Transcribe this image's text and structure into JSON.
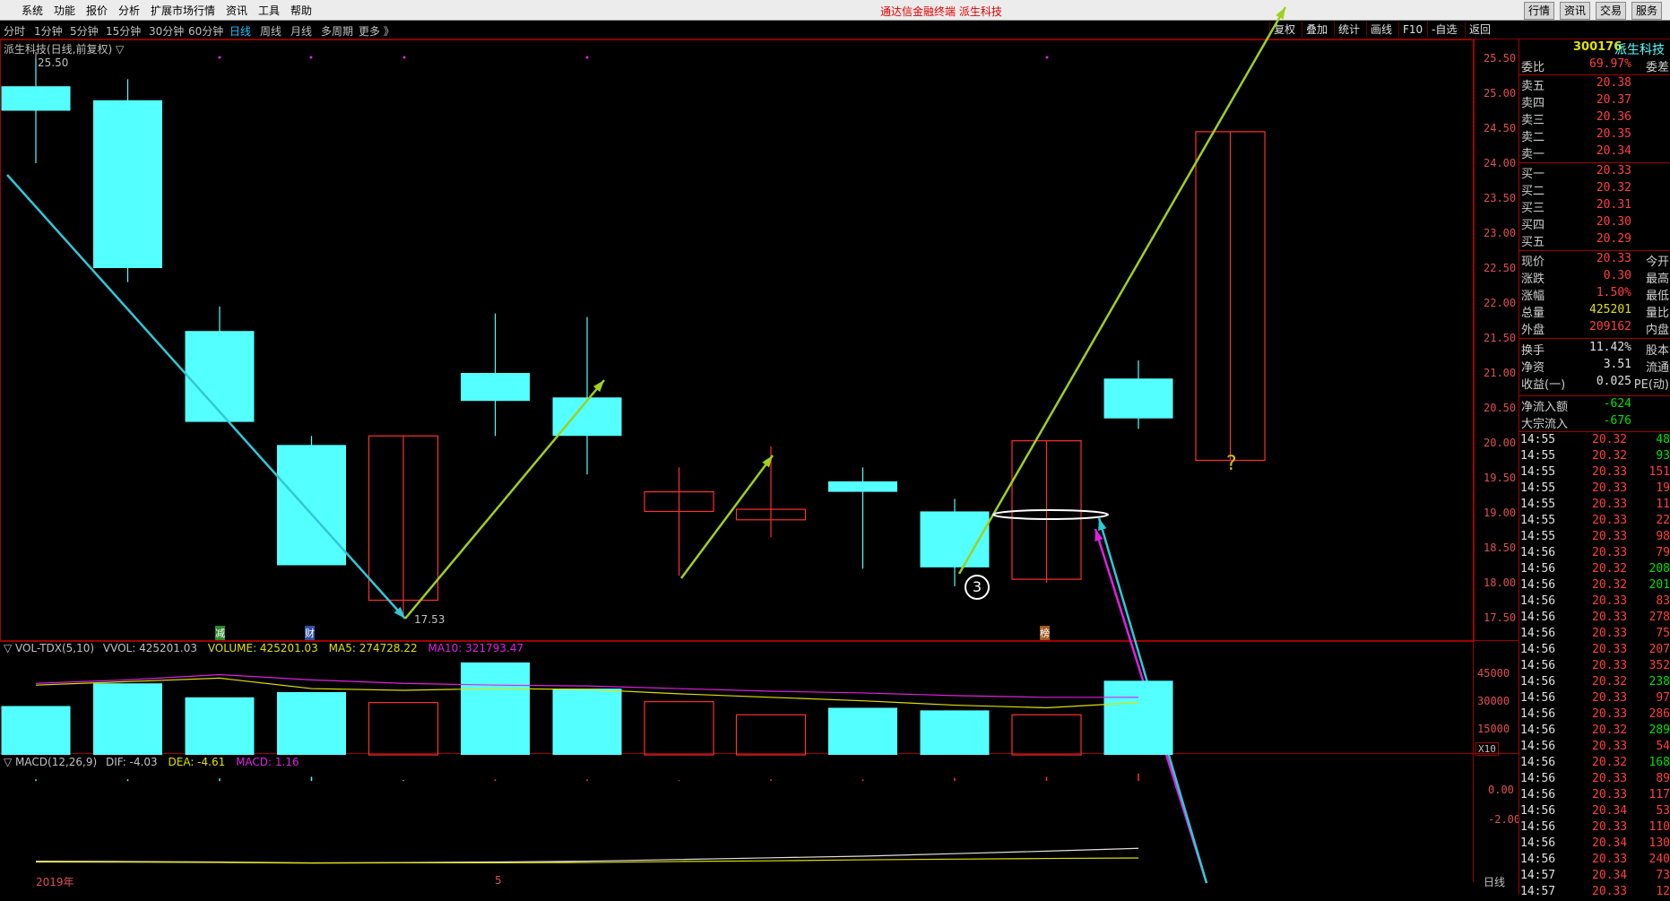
{
  "menu": [
    "系统",
    "功能",
    "报价",
    "分析",
    "扩展市场行情",
    "资讯",
    "工具",
    "帮助"
  ],
  "app_title": "通达信金融终端  派生科技",
  "top_tabs": [
    "行情",
    "资讯",
    "交易",
    "服务"
  ],
  "periods": [
    "分时",
    "1分钟",
    "5分钟",
    "15分钟",
    "30分钟",
    "60分钟",
    "日线",
    "周线",
    "月线",
    "多周期",
    "更多 》"
  ],
  "active_period": "日线",
  "toolbar": [
    "复权",
    "叠加",
    "统计",
    "画线",
    "F10",
    "-自选",
    "返回"
  ],
  "main_panel_title": "派生科技(日线,前复权) ▽",
  "price_axis": [
    "25.50",
    "25.00",
    "24.50",
    "24.00",
    "23.50",
    "23.00",
    "22.50",
    "22.00",
    "21.50",
    "21.00",
    "20.50",
    "20.00",
    "19.50",
    "19.00",
    "18.50",
    "18.00",
    "17.50"
  ],
  "high_label": "25.50",
  "low_label": "17.53",
  "marker_jian": "减",
  "marker_cai": "财",
  "marker_bang": "榜",
  "circle_number": "3",
  "question_mark": "?",
  "vol_title": {
    "name": "▽ VOL-TDX(5,10)",
    "vvol": "VVOL: 425201.03",
    "volume": "VOLUME: 425201.03",
    "ma5": "MA5: 274728.22",
    "ma10": "MA10: 321793.47"
  },
  "vol_axis": [
    "45000",
    "30000",
    "15000"
  ],
  "vol_unit": "X10",
  "macd_title": {
    "name": "▽ MACD(12,26,9)",
    "dif": "DIF: -4.03",
    "dea": "DEA: -4.61",
    "macd": "MACD: 1.16"
  },
  "macd_axis": [
    "0.00",
    "-2.00"
  ],
  "x_labels": {
    "year": "2019年",
    "month": "5"
  },
  "bottom_right": "日线",
  "quote": {
    "code": "300176",
    "name": "派生科技",
    "weibi_label": "委比",
    "weibi": "69.97%",
    "weicha_label": "委差",
    "sells": [
      [
        "卖五",
        "20.38"
      ],
      [
        "卖四",
        "20.37"
      ],
      [
        "卖三",
        "20.36"
      ],
      [
        "卖二",
        "20.35"
      ],
      [
        "卖一",
        "20.34"
      ]
    ],
    "buys": [
      [
        "买一",
        "20.33"
      ],
      [
        "买二",
        "20.32"
      ],
      [
        "买三",
        "20.31"
      ],
      [
        "买四",
        "20.30"
      ],
      [
        "买五",
        "20.29"
      ]
    ],
    "stats": [
      [
        "现价",
        "20.33",
        "今开"
      ],
      [
        "涨跌",
        "0.30",
        "最高"
      ],
      [
        "涨幅",
        "1.50%",
        "最低"
      ],
      [
        "总量",
        "425201",
        "量比"
      ],
      [
        "外盘",
        "209162",
        "内盘"
      ],
      [
        "换手",
        "11.42%",
        "股本"
      ],
      [
        "净资",
        "3.51",
        "流通"
      ],
      [
        "收益(一)",
        "0.025",
        "PE(动)"
      ]
    ],
    "flows": [
      [
        "净流入额",
        "-624"
      ],
      [
        "大宗流入",
        "-676"
      ]
    ]
  },
  "ticks": [
    [
      "14:55",
      "20.32",
      "48"
    ],
    [
      "14:55",
      "20.32",
      "93"
    ],
    [
      "14:55",
      "20.33",
      "151"
    ],
    [
      "14:55",
      "20.33",
      "19"
    ],
    [
      "14:55",
      "20.33",
      "11"
    ],
    [
      "14:55",
      "20.33",
      "22"
    ],
    [
      "14:55",
      "20.33",
      "98"
    ],
    [
      "14:56",
      "20.33",
      "79"
    ],
    [
      "14:56",
      "20.32",
      "208"
    ],
    [
      "14:56",
      "20.32",
      "201"
    ],
    [
      "14:56",
      "20.33",
      "83"
    ],
    [
      "14:56",
      "20.33",
      "278"
    ],
    [
      "14:56",
      "20.33",
      "75"
    ],
    [
      "14:56",
      "20.33",
      "207"
    ],
    [
      "14:56",
      "20.33",
      "352"
    ],
    [
      "14:56",
      "20.32",
      "238"
    ],
    [
      "14:56",
      "20.33",
      "97"
    ],
    [
      "14:56",
      "20.33",
      "286"
    ],
    [
      "14:56",
      "20.32",
      "289"
    ],
    [
      "14:56",
      "20.33",
      "54"
    ],
    [
      "14:56",
      "20.32",
      "168"
    ],
    [
      "14:56",
      "20.33",
      "89"
    ],
    [
      "14:56",
      "20.33",
      "117"
    ],
    [
      "14:56",
      "20.34",
      "53"
    ],
    [
      "14:56",
      "20.33",
      "110"
    ],
    [
      "14:56",
      "20.34",
      "130"
    ],
    [
      "14:56",
      "20.33",
      "240"
    ],
    [
      "14:57",
      "20.34",
      "73"
    ],
    [
      "14:57",
      "20.33",
      "12"
    ]
  ],
  "colors": {
    "up": "#ff3030",
    "down": "#54ffff",
    "bg": "#000000",
    "frame": "#a00000",
    "ma5": "#e0e000",
    "ma10": "#e020e0"
  },
  "chart_data": {
    "type": "candlestick",
    "ylim": [
      17.3,
      25.6
    ],
    "candles": [
      {
        "open": 24.75,
        "close": 25.1,
        "high": 25.5,
        "low": 24.0,
        "dir": "down"
      },
      {
        "open": 24.9,
        "close": 22.5,
        "high": 25.2,
        "low": 22.3,
        "dir": "down"
      },
      {
        "open": 21.6,
        "close": 20.3,
        "high": 21.95,
        "low": 20.3,
        "dir": "down"
      },
      {
        "open": 19.97,
        "close": 18.25,
        "high": 20.1,
        "low": 18.25,
        "dir": "down"
      },
      {
        "open": 17.75,
        "close": 20.1,
        "high": 20.1,
        "low": 17.53,
        "dir": "up"
      },
      {
        "open": 21.0,
        "close": 20.6,
        "high": 21.85,
        "low": 20.1,
        "dir": "down"
      },
      {
        "open": 20.65,
        "close": 20.1,
        "high": 21.8,
        "low": 19.55,
        "dir": "down"
      },
      {
        "open": 19.02,
        "close": 19.3,
        "high": 19.65,
        "low": 18.1,
        "dir": "up"
      },
      {
        "open": 18.9,
        "close": 19.05,
        "high": 19.95,
        "low": 18.65,
        "dir": "up"
      },
      {
        "open": 19.45,
        "close": 19.3,
        "high": 19.65,
        "low": 18.2,
        "dir": "down"
      },
      {
        "open": 19.02,
        "close": 18.22,
        "high": 19.2,
        "low": 17.95,
        "dir": "down"
      },
      {
        "open": 18.05,
        "close": 20.03,
        "high": 20.03,
        "low": 18.0,
        "dir": "up"
      },
      {
        "open": 20.92,
        "close": 20.35,
        "high": 21.18,
        "low": 20.2,
        "dir": "down"
      },
      {
        "open": 19.75,
        "close": 24.45,
        "high": 24.45,
        "low": 19.75,
        "dir": "up"
      }
    ],
    "volume": [
      28000,
      41000,
      33000,
      36000,
      30000,
      53000,
      38000,
      30500,
      23000,
      27000,
      25500,
      23000,
      42500
    ],
    "vol_dir": [
      "down",
      "down",
      "down",
      "down",
      "up",
      "down",
      "down",
      "up",
      "up",
      "down",
      "down",
      "up",
      "down"
    ],
    "vol_ylim": [
      0,
      55000
    ],
    "ma5": [
      40000,
      42000,
      44000,
      38000,
      37000,
      38000,
      37500,
      35000,
      33000,
      31000,
      28500,
      27000,
      30000
    ],
    "ma10": [
      41000,
      43000,
      46000,
      43000,
      41000,
      40000,
      39500,
      38000,
      36500,
      35500,
      34000,
      33000,
      33000
    ],
    "macd": [
      0.1,
      0.1,
      0.15,
      0.25,
      0.05,
      0.1,
      0.1,
      0.05,
      0.1,
      0.1,
      0.2,
      0.25,
      0.45
    ],
    "dif": [
      -4.8,
      -4.82,
      -4.85,
      -4.9,
      -4.88,
      -4.85,
      -4.8,
      -4.7,
      -4.6,
      -4.5,
      -4.35,
      -4.2,
      -4.03
    ],
    "dea": [
      -4.85,
      -4.86,
      -4.88,
      -4.92,
      -4.9,
      -4.9,
      -4.88,
      -4.82,
      -4.78,
      -4.72,
      -4.68,
      -4.64,
      -4.61
    ],
    "macd_ylim": [
      -5.2,
      0.6
    ]
  }
}
